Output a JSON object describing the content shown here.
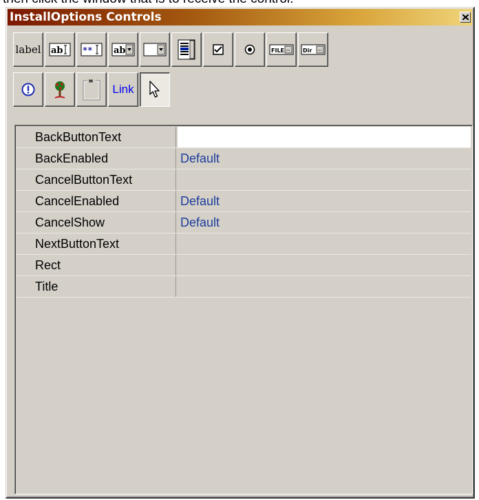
{
  "caption": "then click the window that is to receive the control.",
  "window": {
    "title": "InstallOptions Controls"
  },
  "toolbox": {
    "label_text": "label",
    "link_text": "Link",
    "textbox_glyph": "ab",
    "droplist_glyph": "ab",
    "file_text": "FILE",
    "dir_text": "Dir",
    "tools": [
      "label-icon",
      "textbox-icon",
      "password-icon",
      "droplist-icon",
      "combobox-icon",
      "listbox-icon",
      "checkbox-icon",
      "radiobutton-icon",
      "filerequest-icon",
      "dirrequest-icon",
      "icon-control-icon",
      "bitmap-icon",
      "groupbox-icon",
      "link-icon",
      "pointer-icon"
    ]
  },
  "properties": [
    {
      "name": "BackButtonText",
      "value": ""
    },
    {
      "name": "BackEnabled",
      "value": "Default"
    },
    {
      "name": "CancelButtonText",
      "value": ""
    },
    {
      "name": "CancelEnabled",
      "value": "Default"
    },
    {
      "name": "CancelShow",
      "value": "Default"
    },
    {
      "name": "NextButtonText",
      "value": ""
    },
    {
      "name": "Rect",
      "value": ""
    },
    {
      "name": "Title",
      "value": ""
    }
  ],
  "colors": {
    "title_gradient_start": "#7b1800",
    "title_gradient_end": "#efd47a",
    "value_text": "#1c3c9c",
    "face": "#d4d0c8"
  }
}
